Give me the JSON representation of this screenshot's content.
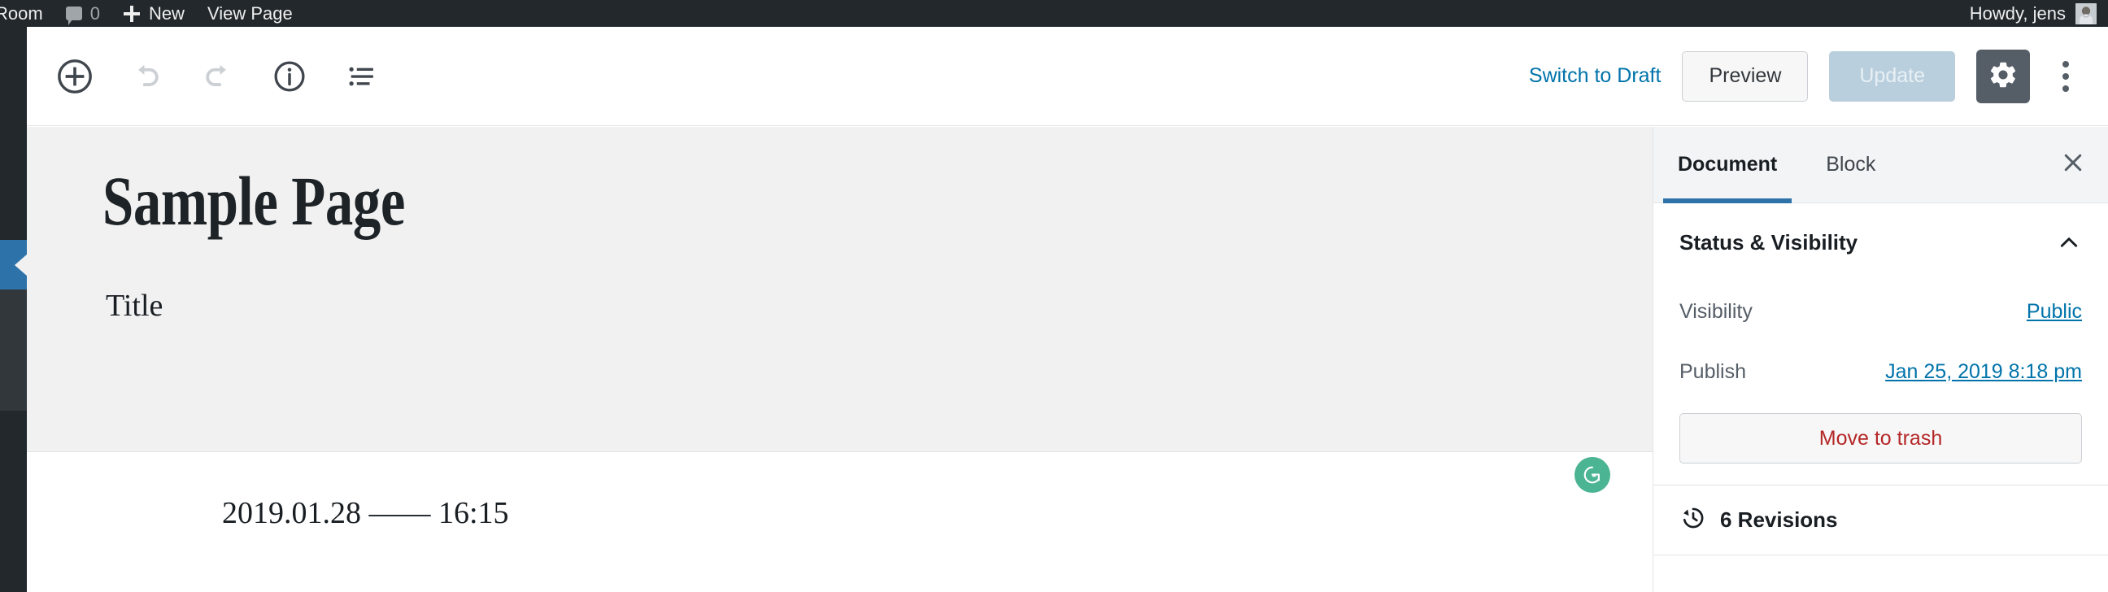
{
  "adminbar": {
    "site_label": "Room",
    "comment_icon": "comment-bubble-icon",
    "comment_count": "0",
    "new_label": "New",
    "view_page_label": "View Page",
    "howdy": "Howdy, jens",
    "avatar": "user-avatar"
  },
  "header": {
    "tools": [
      {
        "name": "add-block-icon",
        "label": "Add block"
      },
      {
        "name": "undo-icon",
        "label": "Undo"
      },
      {
        "name": "redo-icon",
        "label": "Redo"
      },
      {
        "name": "content-info-icon",
        "label": "Content structure"
      },
      {
        "name": "block-navigation-icon",
        "label": "Block navigation"
      }
    ],
    "switch_to_draft": "Switch to Draft",
    "preview": "Preview",
    "update": "Update",
    "settings_icon": "gear-icon",
    "more_menu_icon": "more-vertical-icon"
  },
  "canvas": {
    "post_title": "Sample Page",
    "post_subtitle": "Title",
    "grammarly_icon": "grammarly-icon",
    "date_line": "2019.01.28 —— 16:15"
  },
  "settings": {
    "tabs": [
      {
        "label": "Document",
        "active": true
      },
      {
        "label": "Block",
        "active": false
      }
    ],
    "close_icon": "close-icon",
    "status_panel": {
      "title": "Status & Visibility",
      "chevron_icon": "chevron-up-icon",
      "visibility_label": "Visibility",
      "visibility_value": "Public",
      "publish_label": "Publish",
      "publish_value": "Jan 25, 2019 8:18 pm",
      "trash_label": "Move to trash"
    },
    "revisions": {
      "icon": "revision-clock-icon",
      "label": "6 Revisions"
    }
  },
  "colors": {
    "admin_dark": "#23282d",
    "admin_hover": "#32373c",
    "accent_blue": "#2e72aa",
    "link_blue": "#0073aa",
    "danger_red": "#b52727",
    "grammarly_green": "#4bb493",
    "canvas_gray": "#f1f1f1"
  }
}
